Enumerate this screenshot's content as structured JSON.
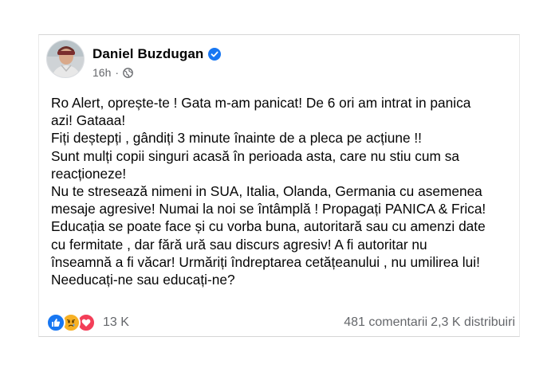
{
  "post": {
    "author": "Daniel Buzdugan",
    "timestamp": "16h",
    "separator": "·",
    "audience_icon": "globe-icon",
    "verified_icon": "verified-badge-icon",
    "lines": [
      "Ro Alert, oprește-te ! Gata m-am panicat! De 6 ori am intrat in panica",
      "azi! Gataaa!",
      "Fiți deștepți  , gândiți 3 minute înainte de a pleca pe acțiune !!",
      "Sunt mulți copii singuri acasă în perioada asta, care nu stiu cum sa",
      "reacționeze!",
      "Nu te stresează nimeni in SUA, Italia, Olanda, Germania cu asemenea",
      "mesaje agresive! Numai la noi se întâmplă ! Propagați PANICA & Frica!",
      "Educația se poate face și cu vorba buna, autoritară sau cu amenzi date",
      "cu fermitate , dar fără ură sau discurs agresiv! A fi autoritar nu",
      "înseamnă a fi văcar! Urmăriți îndreptarea cetățeanului , nu umilirea lui!",
      "Needucați-ne sau educați-ne?"
    ]
  },
  "footer": {
    "reactions": [
      "like-icon",
      "sad-icon",
      "love-icon"
    ],
    "reaction_count": "13 K",
    "comments": "481 comentarii",
    "shares": "2,3 K distribuiri"
  },
  "colors": {
    "text": "#050505",
    "secondary": "#65676b",
    "verified": "#1877f2",
    "like": "#1877f2",
    "sad": "#f7b125",
    "love": "#f33e58"
  }
}
